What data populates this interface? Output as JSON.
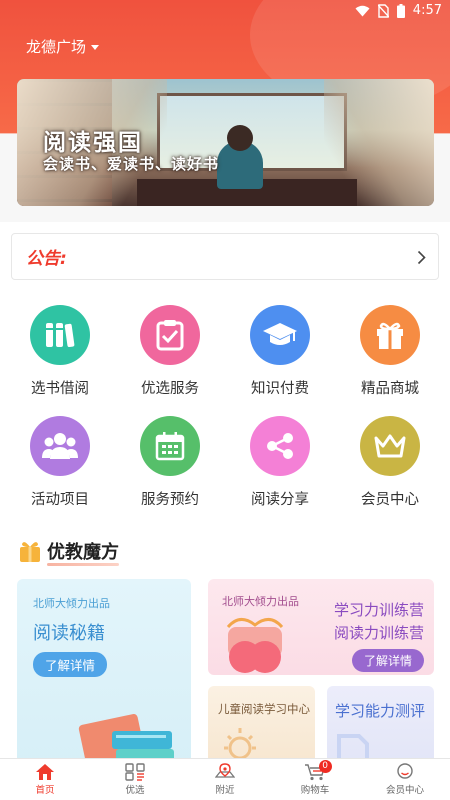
{
  "status_bar": {
    "time": "4:57"
  },
  "header": {
    "location": "龙德广场"
  },
  "banner": {
    "title": "阅读强国",
    "subtitle": "会读书、爱读书、读好书"
  },
  "notice": {
    "label": "公告:"
  },
  "grid": [
    {
      "label": "选书借阅",
      "icon": "books-icon",
      "color": "#2fc3a3"
    },
    {
      "label": "优选服务",
      "icon": "clipboard-check-icon",
      "color": "#f0679d"
    },
    {
      "label": "知识付费",
      "icon": "graduation-cap-icon",
      "color": "#4e8ff0"
    },
    {
      "label": "精品商城",
      "icon": "gift-icon",
      "color": "#f68c43"
    },
    {
      "label": "活动项目",
      "icon": "people-icon",
      "color": "#b07be0"
    },
    {
      "label": "服务预约",
      "icon": "calendar-icon",
      "color": "#56bf6a"
    },
    {
      "label": "阅读分享",
      "icon": "share-icon",
      "color": "#f480d6"
    },
    {
      "label": "会员中心",
      "icon": "crown-icon",
      "color": "#c9b544"
    }
  ],
  "section": {
    "title": "优教魔方"
  },
  "cards": {
    "a": {
      "tag": "北师大倾力出品",
      "title": "阅读秘籍",
      "button": "了解详情"
    },
    "b": {
      "tag": "北师大倾力出品",
      "line1": "学习力训练营",
      "line2": "阅读力训练营",
      "button": "了解详情"
    },
    "c": {
      "title": "儿童阅读学习中心"
    },
    "d": {
      "title": "学习能力测评"
    }
  },
  "tabbar": [
    {
      "label": "首页",
      "icon": "home-icon",
      "active": true
    },
    {
      "label": "优选",
      "icon": "grid-list-icon",
      "active": false
    },
    {
      "label": "附近",
      "icon": "map-pin-icon",
      "active": false
    },
    {
      "label": "购物车",
      "icon": "cart-icon",
      "active": false,
      "badge": "0"
    },
    {
      "label": "会员中心",
      "icon": "user-icon",
      "active": false
    }
  ],
  "colors": {
    "brand": "#ef3b2d",
    "header": "#f0523e"
  }
}
